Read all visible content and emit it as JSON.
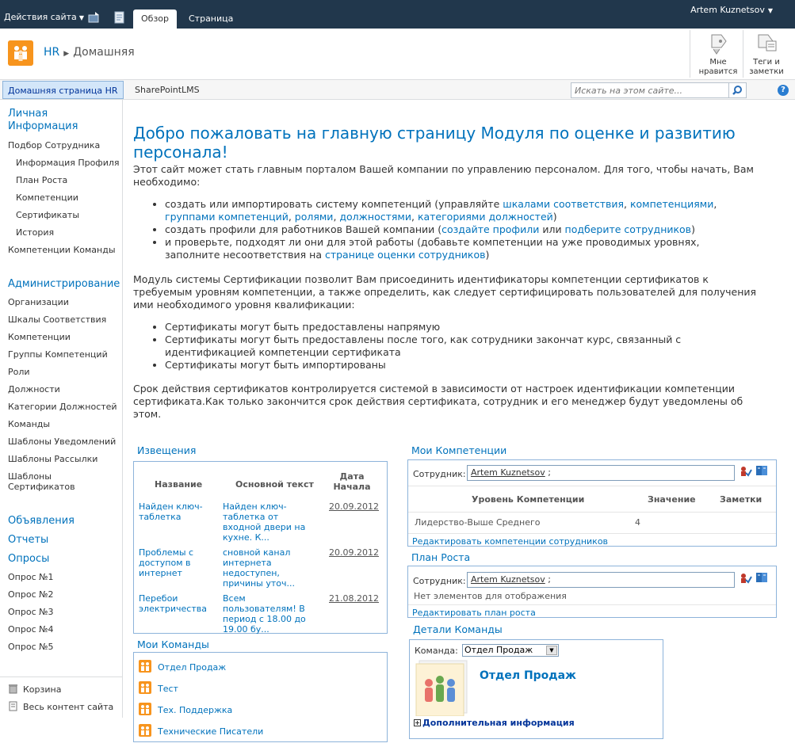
{
  "topbar": {
    "site_actions": "Действия сайта",
    "tabs": [
      "Обзор",
      "Страница"
    ],
    "user": "Artem Kuznetsov"
  },
  "header": {
    "breadcrumb": [
      "HR",
      "Домашняя"
    ],
    "like_label": [
      "Мне",
      "нравится"
    ],
    "tags_label": [
      "Теги и",
      "заметки"
    ]
  },
  "nav": {
    "home": "Домашняя страница HR",
    "items": [
      "SharePointLMS"
    ],
    "search_placeholder": "Искать на этом сайте..."
  },
  "leftnav": {
    "personal_heading": [
      "Личная",
      "Информация"
    ],
    "personal_items": [
      "Подбор Сотрудника",
      "Информация Профиля",
      "План Роста",
      "Компетенции",
      "Сертификаты",
      "История",
      "Компетенции Команды"
    ],
    "admin_heading": "Администрирование",
    "admin_items": [
      "Организации",
      "Шкалы Соответствия",
      "Компетенции",
      "Группы Компетенций",
      "Роли",
      "Должности",
      "Категории Должностей",
      "Команды",
      "Шаблоны Уведомлений",
      "Шаблоны Рассылки",
      "Шаблоны",
      "Сертификатов"
    ],
    "announcements": "Объявления",
    "reports": "Отчеты",
    "surveys": "Опросы",
    "survey_items": [
      "Опрос №1",
      "Опрос №2",
      "Опрос №3",
      "Опрос №4",
      "Опрос №5"
    ],
    "recycle": "Корзина",
    "all_content": "Весь контент сайта"
  },
  "welcome": {
    "title": [
      "Добро пожаловать на главную страницу Модуля по оценке и развитию",
      "персонала!"
    ],
    "intro": "Этот сайт может стать главным порталом Вашей компании по управлению персоналом. Для того, чтобы начать, Вам необходимо:",
    "bullets1": [
      [
        "создать или импортировать систему компетенций (управляйте ",
        "шкалами соответствия",
        ", ",
        "компетенциями",
        ", ",
        "группами компетенций",
        ", ",
        "ролями",
        ", ",
        "должностями",
        ", ",
        "категориями должностей",
        ")"
      ],
      [
        "создать профили для работников Вашей компании (",
        "создайте профили",
        " или ",
        "подберите сотрудников",
        ")"
      ],
      [
        "и проверьте, подходят ли они для этой работы (добавьте компетенции на уже проводимых уровнях, заполните несоответствия на ",
        "странице оценки сотрудников",
        ")"
      ]
    ],
    "cert_para": "Модуль системы Сертификации позволит Вам присоединить идентификаторы компетенции сертификатов к требуемым уровням компетенции, а также определить, как следует сертифицировать пользователей для получения ими необходимого уровня квалификации:",
    "bullets2": [
      "Сертификаты могут быть предоставлены напрямую",
      "Сертификаты могут быть предоставлены после того, как сотрудники закончат курс, связанный с идентификацией компетенции сертификата",
      "Сертификаты могут быть импортированы"
    ],
    "expiry_para": "Срок действия сертификатов контролируется системой в зависимости от настроек идентификации компетенции сертификата.Как только закончится срок действия сертификата, сотрудник и его менеджер будут уведомлены об этом."
  },
  "announcements": {
    "title": "Извещения",
    "headers": [
      "Название",
      "Основной текст",
      [
        "Дата",
        "Начала"
      ]
    ],
    "rows": [
      {
        "name": [
          "Найден ключ-",
          "таблетка"
        ],
        "body": [
          "Найден ключ-",
          "таблетка от",
          "входной двери на",
          "кухне. К..."
        ],
        "date": "20.09.2012"
      },
      {
        "name": [
          "Проблемы с",
          "доступом в",
          "интернет"
        ],
        "body": [
          "сновной канал",
          "интернета",
          "недоступен,",
          "причины уточ..."
        ],
        "date": "20.09.2012"
      },
      {
        "name": [
          "Перебои",
          "электричества"
        ],
        "body": [
          "Всем",
          "пользователям! В",
          "период с 18.00 до",
          "19.00 бу..."
        ],
        "date": "21.08.2012"
      }
    ]
  },
  "teams": {
    "title": "Мои Команды",
    "items": [
      "Отдел Продаж",
      "Тест",
      "Тех. Поддержка",
      "Технические Писатели"
    ]
  },
  "competencies": {
    "title": "Мои Компетенции",
    "employee_label": "Сотрудник:",
    "employee": "Artem Kuznetsov",
    "employee_suffix": " ;",
    "headers": [
      "Уровень Компетенции",
      "Значение",
      "Заметки"
    ],
    "rows": [
      {
        "level": "Лидерство-Выше Среднего",
        "value": "4",
        "notes": ""
      }
    ],
    "edit_link": "Редактировать компетенции сотрудников"
  },
  "growth": {
    "title": "План Роста",
    "employee_label": "Сотрудник:",
    "employee": "Artem Kuznetsov",
    "employee_suffix": " ;",
    "empty": "Нет элементов для отображения",
    "edit_link": "Редактировать план роста"
  },
  "team_details": {
    "title": "Детали Команды",
    "team_label": "Команда:",
    "selected": "Отдел Продаж",
    "team_name": "Отдел Продаж",
    "more": "Дополнительная информация"
  },
  "colors": {
    "topbar": "#21374c",
    "link": "#0072bc",
    "accent_orange": "#f7941d",
    "border": "#8db3da"
  }
}
